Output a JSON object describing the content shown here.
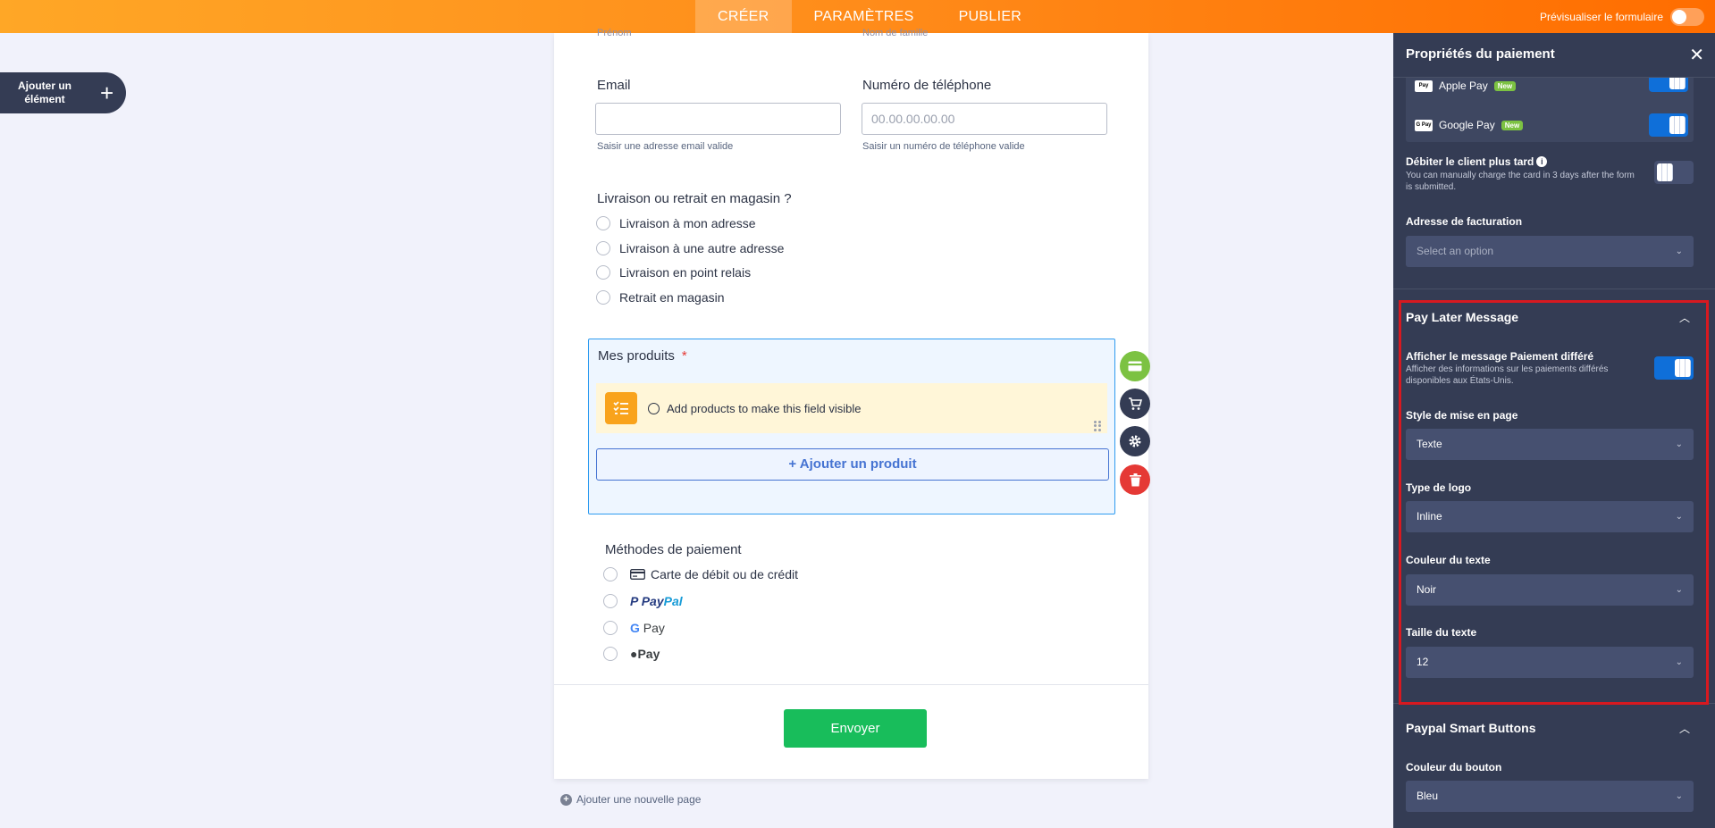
{
  "topbar": {
    "tabs": [
      "CRÉER",
      "PARAMÈTRES",
      "PUBLIER"
    ],
    "preview_label": "Prévisualiser le formulaire"
  },
  "add_element": {
    "label_line1": "Ajouter un",
    "label_line2": "élément",
    "icon": "plus-icon"
  },
  "form": {
    "ghost_left": "Prénom",
    "ghost_right": "Nom de famille",
    "email": {
      "label": "Email",
      "value": "",
      "help": "Saisir une adresse email valide"
    },
    "phone": {
      "label": "Numéro de téléphone",
      "placeholder": "00.00.00.00.00",
      "help": "Saisir un numéro de téléphone valide"
    },
    "delivery": {
      "question": "Livraison ou retrait en magasin ?",
      "options": [
        "Livraison à mon adresse",
        "Livraison à une autre adresse",
        "Livraison en point relais",
        "Retrait en magasin"
      ]
    },
    "products": {
      "title": "Mes produits",
      "required_mark": "*",
      "empty_message": "Add products to make this field visible",
      "add_button": "+ Ajouter un produit"
    },
    "payment": {
      "title": "Méthodes de paiement",
      "card_label": "Carte de débit ou de crédit",
      "paypal_p1": "Pay",
      "paypal_p2": "Pal",
      "gpay_label": "Pay",
      "apay_label": "Pay"
    },
    "submit_label": "Envoyer",
    "add_page_label": "Ajouter une nouvelle page"
  },
  "tool_colors": {
    "card": "#7cc242",
    "cart": "#343c54",
    "settings": "#343c54",
    "delete": "#e53935"
  },
  "panel": {
    "title": "Propriétés du paiement",
    "wallets": [
      {
        "name": "Apple Pay",
        "badge": "New",
        "logo": "Pay"
      },
      {
        "name": "Google Pay",
        "badge": "New",
        "logo": "G Pay"
      }
    ],
    "charge_later": {
      "label": "Débiter le client plus tard",
      "desc": "You can manually charge the card in 3 days after the form is submitted."
    },
    "billing": {
      "label": "Adresse de facturation",
      "placeholder": "Select an option"
    },
    "pay_later": {
      "section_title": "Pay Later Message",
      "show_label": "Afficher le message Paiement différé",
      "show_desc": "Afficher des informations sur les paiements différés disponibles aux États-Unis.",
      "layout_label": "Style de mise en page",
      "layout_value": "Texte",
      "logo_label": "Type de logo",
      "logo_value": "Inline",
      "color_label": "Couleur du texte",
      "color_value": "Noir",
      "size_label": "Taille du texte",
      "size_value": "12"
    },
    "smart_buttons": {
      "section_title": "Paypal Smart Buttons",
      "button_color_label": "Couleur du bouton",
      "button_color_value": "Bleu"
    }
  },
  "colors": {
    "accent_orange": "#ff8c1a",
    "panel_bg": "#343c54",
    "toggle_on": "#0f6fd9",
    "submit_green": "#18bd5b",
    "highlight_red": "#d71920"
  }
}
